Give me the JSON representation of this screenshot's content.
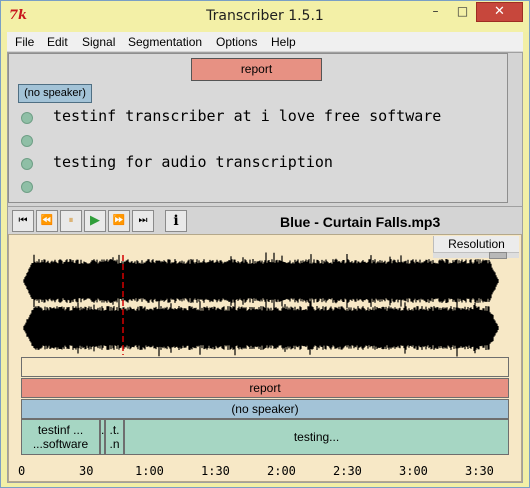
{
  "window": {
    "title": "Transcriber 1.5.1",
    "minimize": "–",
    "maximize": "□",
    "close": "✕"
  },
  "menu": [
    "File",
    "Edit",
    "Signal",
    "Segmentation",
    "Options",
    "Help"
  ],
  "editor": {
    "section_label": "report",
    "speaker_label": "(no speaker)",
    "segments": [
      {
        "text": "testinf transcriber at i love free software"
      },
      {
        "text": "testing for audio transcription"
      },
      {
        "text": ""
      }
    ]
  },
  "toolbar": {
    "buttons": [
      {
        "name": "go-start-icon",
        "glyph": "⏮"
      },
      {
        "name": "rewind-icon",
        "glyph": "⏪"
      },
      {
        "name": "pause-icon",
        "glyph": "⏸"
      },
      {
        "name": "play-icon",
        "glyph": "▶"
      },
      {
        "name": "fast-forward-icon",
        "glyph": "⏩"
      },
      {
        "name": "go-end-icon",
        "glyph": "⏭"
      }
    ],
    "info_glyph": "i",
    "track_title": "Blue - Curtain Falls.mp3"
  },
  "wave": {
    "resolution_label": "Resolution",
    "cursor_color": "#d40000",
    "section_track_label": "report",
    "speaker_track_label": "(no speaker)",
    "segment_cells": [
      {
        "line1": "testinf ...",
        "line2": "...software"
      },
      {
        "line1": ".",
        "line2": ""
      },
      {
        "line1": ".t.",
        "line2": ".n"
      },
      {
        "line1": "testing...",
        "line2": ""
      }
    ],
    "time_ticks": [
      "0",
      "30",
      "1:00",
      "1:30",
      "2:00",
      "2:30",
      "3:00",
      "3:30"
    ]
  },
  "colors": {
    "section": "#e79183",
    "speaker": "#a3c3d7",
    "segment": "#a6d6c3",
    "wave_background": "#f7e8c6",
    "waveform": "#000000"
  }
}
